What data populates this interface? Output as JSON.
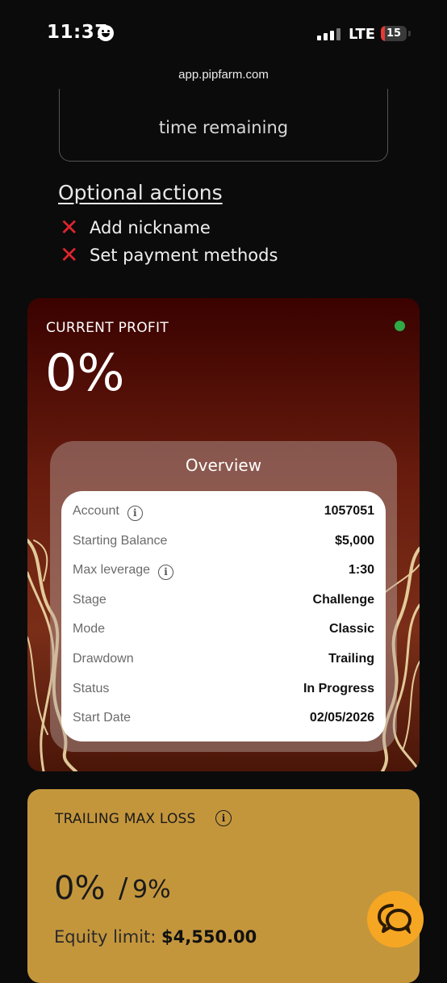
{
  "status_bar": {
    "time": "11:37",
    "network": "LTE",
    "battery_level": "15",
    "battery_fraction": 0.15
  },
  "browser": {
    "url": "app.pipfarm.com"
  },
  "countdown": {
    "caption": "time remaining"
  },
  "optional_actions": {
    "title": "Optional actions",
    "items": [
      {
        "label": "Add nickname",
        "done": false
      },
      {
        "label": "Set payment methods",
        "done": false
      }
    ]
  },
  "profit": {
    "label": "CURRENT PROFIT",
    "value": "0%",
    "status_color": "#2faa46"
  },
  "overview": {
    "title": "Overview",
    "rows": [
      {
        "label": "Account",
        "value": "1057051",
        "info": true
      },
      {
        "label": "Starting Balance",
        "value": "$5,000",
        "info": false
      },
      {
        "label": "Max leverage",
        "value": "1:30",
        "info": true
      },
      {
        "label": "Stage",
        "value": "Challenge",
        "info": false
      },
      {
        "label": "Mode",
        "value": "Classic",
        "info": false
      },
      {
        "label": "Drawdown",
        "value": "Trailing",
        "info": false
      },
      {
        "label": "Status",
        "value": "In Progress",
        "info": false
      },
      {
        "label": "Start Date",
        "value": "02/05/2026",
        "info": false
      }
    ]
  },
  "max_loss": {
    "title": "TRAILING MAX LOSS",
    "current": "0%",
    "separator": "/",
    "limit": "9%",
    "equity_label": "Equity limit:",
    "equity_value": "$4,550.00"
  },
  "colors": {
    "background": "#0b0b0b",
    "profit_card": "#6a1d0e",
    "loss_card": "#c4963c",
    "chat_button": "#f5a623",
    "x_mark": "#e0242c"
  },
  "icons": {
    "x_mark": "cross-mark-icon",
    "info": "info-icon",
    "chat": "chat-bubbles-icon"
  }
}
